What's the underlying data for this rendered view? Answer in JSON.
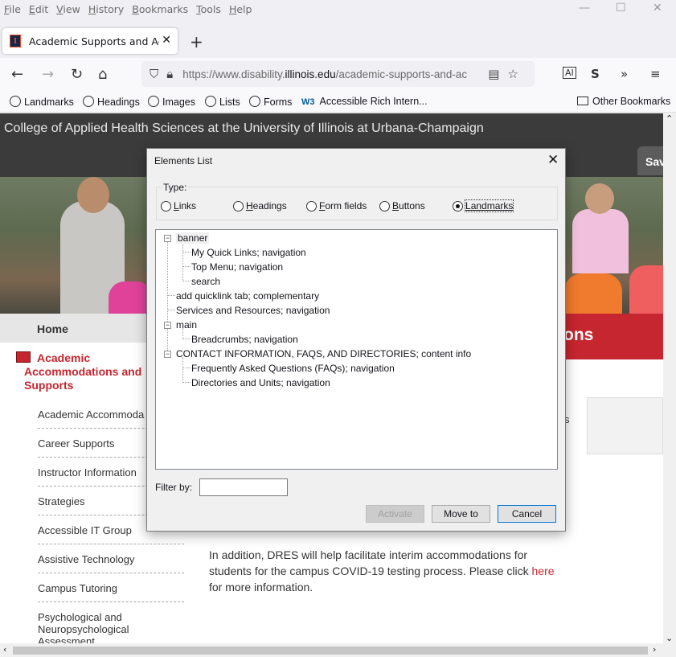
{
  "menu": [
    "File",
    "Edit",
    "View",
    "History",
    "Bookmarks",
    "Tools",
    "Help"
  ],
  "tab": {
    "title": "Academic Supports and Accom",
    "favicon": "I"
  },
  "address": {
    "prefix": "https://www.disability.",
    "domain": "illinois.edu",
    "path": "/academic-supports-and-ac"
  },
  "bookmarks": [
    {
      "label": "Landmarks"
    },
    {
      "label": "Headings"
    },
    {
      "label": "Images"
    },
    {
      "label": "Lists"
    },
    {
      "label": "Forms"
    },
    {
      "label": "Accessible Rich Intern...",
      "icon": "W3"
    },
    {
      "label": "Other Bookmarks"
    }
  ],
  "page": {
    "college": "College of Applied Health Sciences at the University of Illinois at Urbana-Champaign",
    "save_label": "Sav",
    "red_heading": "ons",
    "home": "Home",
    "active_section": "Academic Accommodations and Supports",
    "side_items": [
      "Academic Accommoda",
      "Career Supports",
      "Instructor Information",
      "Strategies",
      "Accessible IT Group",
      "Assistive Technology",
      "Campus Tutoring",
      "Psychological and Neuropsychological Assessment"
    ],
    "body_text": "In addition, DRES will help facilitate interim accommodations for students for the campus COVID-19 testing process.  Please click",
    "body_link": "here",
    "body_text_end": "for more information.",
    "frag1": "s"
  },
  "dialog": {
    "title": "Elements List",
    "type_label": "Type:",
    "radios": [
      "Links",
      "Headings",
      "Form fields",
      "Buttons",
      "Landmarks"
    ],
    "selected": "Landmarks",
    "tree": [
      "banner",
      "My Quick Links; navigation",
      "Top Menu; navigation",
      "search",
      "add quicklink tab; complementary",
      "Services and Resources; navigation",
      "main",
      "Breadcrumbs; navigation",
      "CONTACT INFORMATION, FAQS, AND DIRECTORIES; content info",
      "Frequently Asked Questions (FAQs); navigation",
      "Directories and Units; navigation"
    ],
    "filter_label": "Filter by:",
    "filter_value": "",
    "buttons": {
      "activate": "Activate",
      "move_to": "Move to",
      "cancel": "Cancel"
    }
  }
}
